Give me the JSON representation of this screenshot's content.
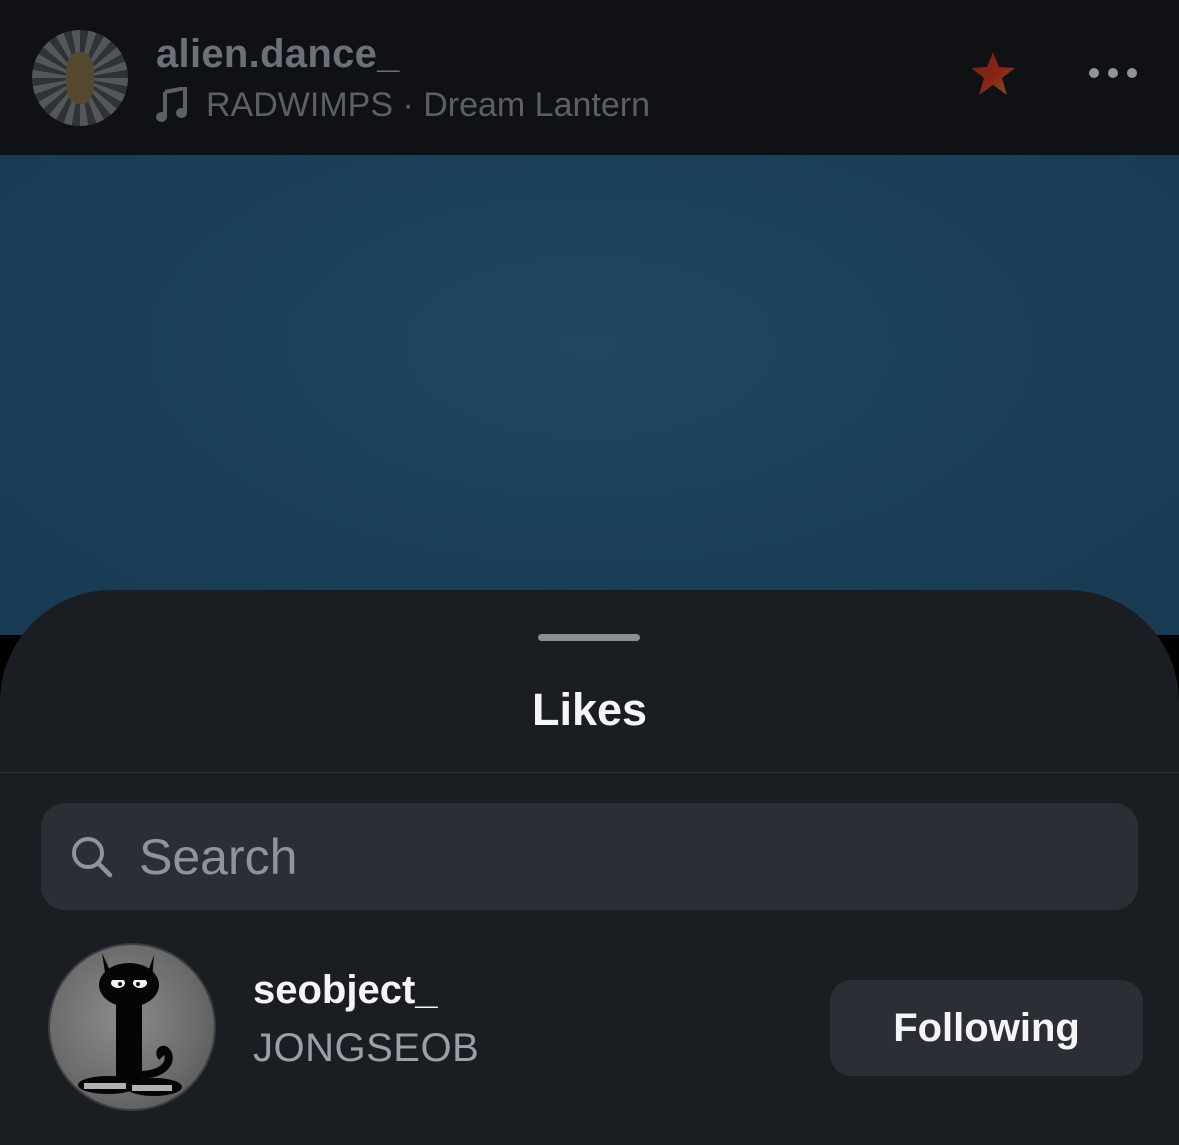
{
  "post": {
    "username": "alien.dance_",
    "music_line": "RADWIMPS · Dream Lantern"
  },
  "sheet": {
    "title": "Likes",
    "search": {
      "placeholder": "Search",
      "value": ""
    },
    "users": [
      {
        "username": "seobject_",
        "full_name": "JONGSEOB",
        "button": "Following"
      }
    ]
  },
  "colors": {
    "sheet_background": "#1a1d21",
    "button_background": "#2b2e35",
    "image_tint": "#1b3f58"
  }
}
